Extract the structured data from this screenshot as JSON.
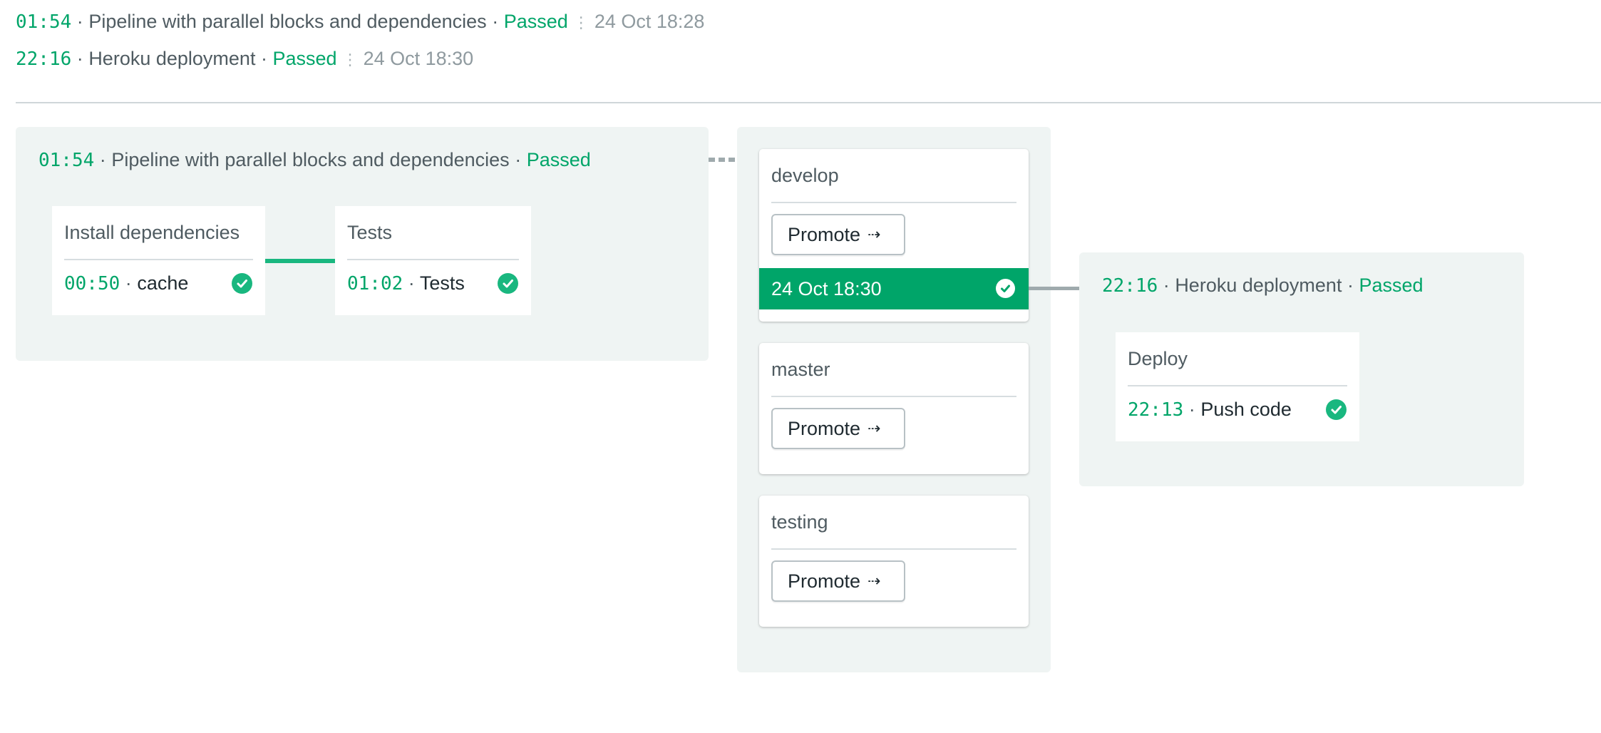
{
  "history": [
    {
      "time": "01:54",
      "name": "Pipeline with parallel blocks and dependencies",
      "status": "Passed",
      "date": "24 Oct 18:28"
    },
    {
      "time": "22:16",
      "name": "Heroku deployment",
      "status": "Passed",
      "date": "24 Oct 18:30"
    }
  ],
  "separator": "·",
  "meta_separator": "⋮",
  "pipeline": {
    "time": "01:54",
    "name": "Pipeline with parallel blocks and dependencies",
    "status": "Passed",
    "blocks": [
      {
        "name": "Install dependencies",
        "job_time": "00:50",
        "job_name": "cache",
        "status_icon": "check-circle-icon"
      },
      {
        "name": "Tests",
        "job_time": "01:02",
        "job_name": "Tests",
        "status_icon": "check-circle-icon"
      }
    ]
  },
  "promotions": [
    {
      "branch": "develop",
      "button_label": "Promote",
      "button_icon": "dotted-arrow-right-icon",
      "last_run": "24 Oct 18:30",
      "last_run_status_icon": "check-circle-icon"
    },
    {
      "branch": "master",
      "button_label": "Promote",
      "button_icon": "dotted-arrow-right-icon"
    },
    {
      "branch": "testing",
      "button_label": "Promote",
      "button_icon": "dotted-arrow-right-icon"
    }
  ],
  "deployment": {
    "time": "22:16",
    "name": "Heroku deployment",
    "status": "Passed",
    "blocks": [
      {
        "name": "Deploy",
        "job_time": "22:13",
        "job_name": "Push code",
        "status_icon": "check-circle-icon"
      }
    ]
  },
  "arrow_glyph": "⇢",
  "colors": {
    "accent_green": "#00a569",
    "check_green": "#19b77f",
    "panel_bg": "#eff4f3",
    "text": "#4f5b61",
    "muted": "#8f9a9f"
  }
}
